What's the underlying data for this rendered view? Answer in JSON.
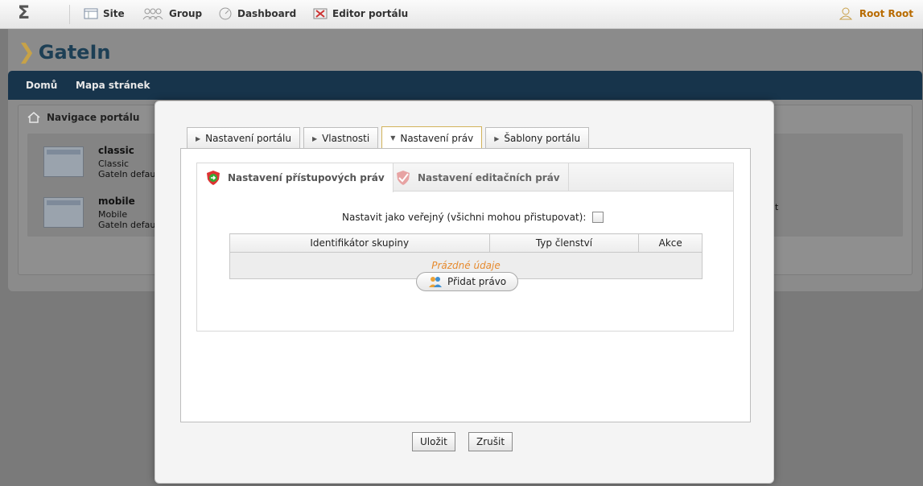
{
  "toolbar": {
    "logo_glyph": "Ʃ",
    "site": "Site",
    "group": "Group",
    "dashboard": "Dashboard",
    "editor": "Editor portálu",
    "user": "Root Root"
  },
  "brand": {
    "logo_text": "GateIn"
  },
  "nav": {
    "home": "Domů",
    "sitemap": "Mapa stránek"
  },
  "portal_nav": {
    "title": "Navigace portálu",
    "items": [
      {
        "name": "classic",
        "label": "Classic",
        "desc": "GateIn defau"
      },
      {
        "name": "mobile",
        "label": "Mobile",
        "desc": "GateIn defau"
      }
    ],
    "stray_text": "t"
  },
  "modal": {
    "tabs": [
      {
        "label": "Nastavení portálu",
        "active": false
      },
      {
        "label": "Vlastnosti",
        "active": false
      },
      {
        "label": "Nastavení práv",
        "active": true
      },
      {
        "label": "Šablony portálu",
        "active": false
      }
    ],
    "subtabs": {
      "access": "Nastavení přístupových práv",
      "edit": "Nastavení editačních práv"
    },
    "public_label": "Nastavit jako veřejný (všichni mohou přistupovat):",
    "table": {
      "headers": [
        "Identifikátor skupiny",
        "Typ členství",
        "Akce"
      ],
      "empty": "Prázdné údaje"
    },
    "add_button": "Přidat právo",
    "save_button": "Uložit",
    "cancel_button": "Zrušit"
  },
  "colors": {
    "accent": "#c7a248",
    "nav_bg": "#17344b",
    "empty_text": "#e68a2e"
  }
}
